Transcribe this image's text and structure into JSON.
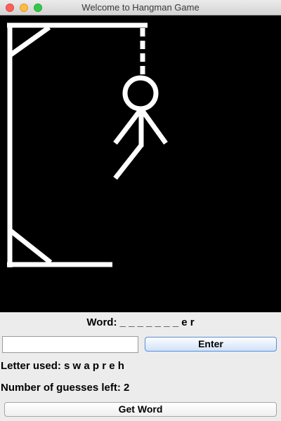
{
  "window": {
    "title": "Welcome to Hangman Game"
  },
  "game": {
    "word_label": "Word:",
    "word_pattern": "_ _ _ _ _ _ _ e r",
    "guess_input_value": "",
    "enter_label": "Enter",
    "letters_used_label": "Letter used:",
    "letters_used": "s w a p r e h",
    "guesses_left_label": "Number of guesses left:",
    "guesses_left": "2",
    "get_word_label": "Get Word"
  },
  "hangman_parts_drawn": [
    "head",
    "body",
    "left-arm",
    "right-arm",
    "left-leg"
  ],
  "colors": {
    "canvas_bg": "#000000",
    "drawing": "#ffffff"
  }
}
